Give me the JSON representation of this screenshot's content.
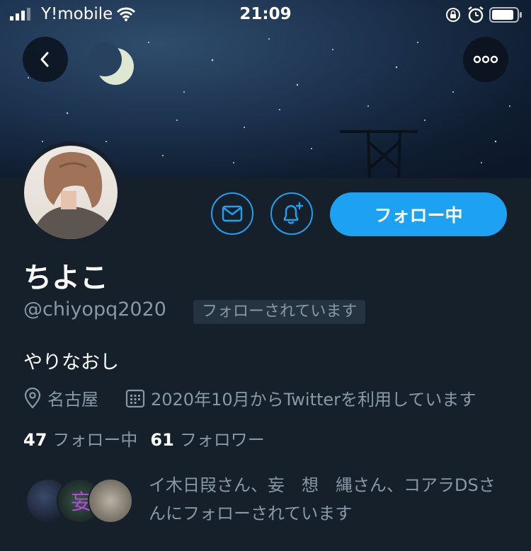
{
  "status_bar": {
    "carrier": "Y!mobile",
    "time": "21:09"
  },
  "profile": {
    "display_name": "ちよこ",
    "handle": "@chiyopq2020",
    "follows_you_badge": "フォローされています",
    "bio": "やりなおし",
    "location": "名古屋",
    "joined": "2020年10月からTwitterを利用しています",
    "following_count": "47",
    "following_label": "フォロー中",
    "followers_count": "61",
    "followers_label": "フォロワー",
    "followed_by": "イ木日叚さん、妄　想　縄さん、コアラDSさんにフォローされています"
  },
  "actions": {
    "follow_button_label": "フォロー中"
  },
  "icons": {
    "back": "chevron-left-icon",
    "more": "more-dots-icon",
    "mail": "mail-icon",
    "bell": "bell-plus-icon",
    "location": "location-pin-icon",
    "calendar": "calendar-icon"
  },
  "colors": {
    "accent": "#1da1f2",
    "background": "#15202b",
    "secondary_text": "#8899a6"
  }
}
